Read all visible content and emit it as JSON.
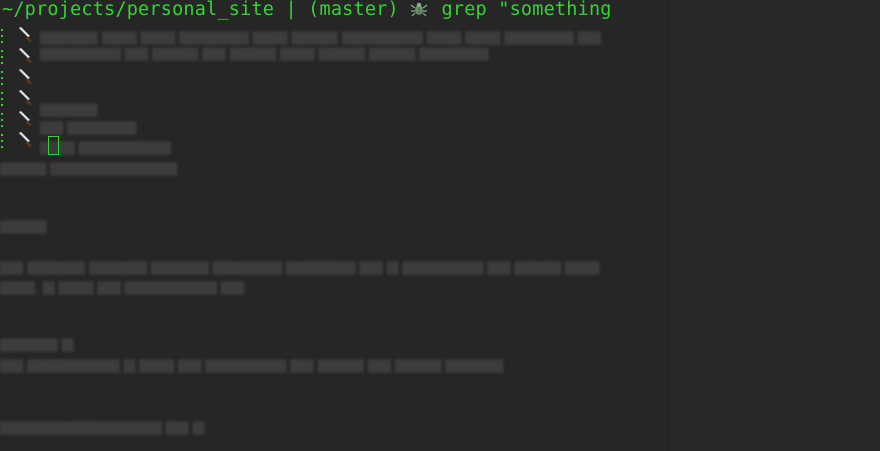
{
  "terminal": {
    "prompt_path": "~/projects/personal_site",
    "prompt_sep": " | ",
    "prompt_branch": "(master)",
    "prompt_icon": "bug-icon",
    "command": "grep \"something",
    "continuation_icon": "knife-icon",
    "continuation_lines": 6,
    "prompt_color": "#35d435",
    "background_color": "#262626"
  }
}
